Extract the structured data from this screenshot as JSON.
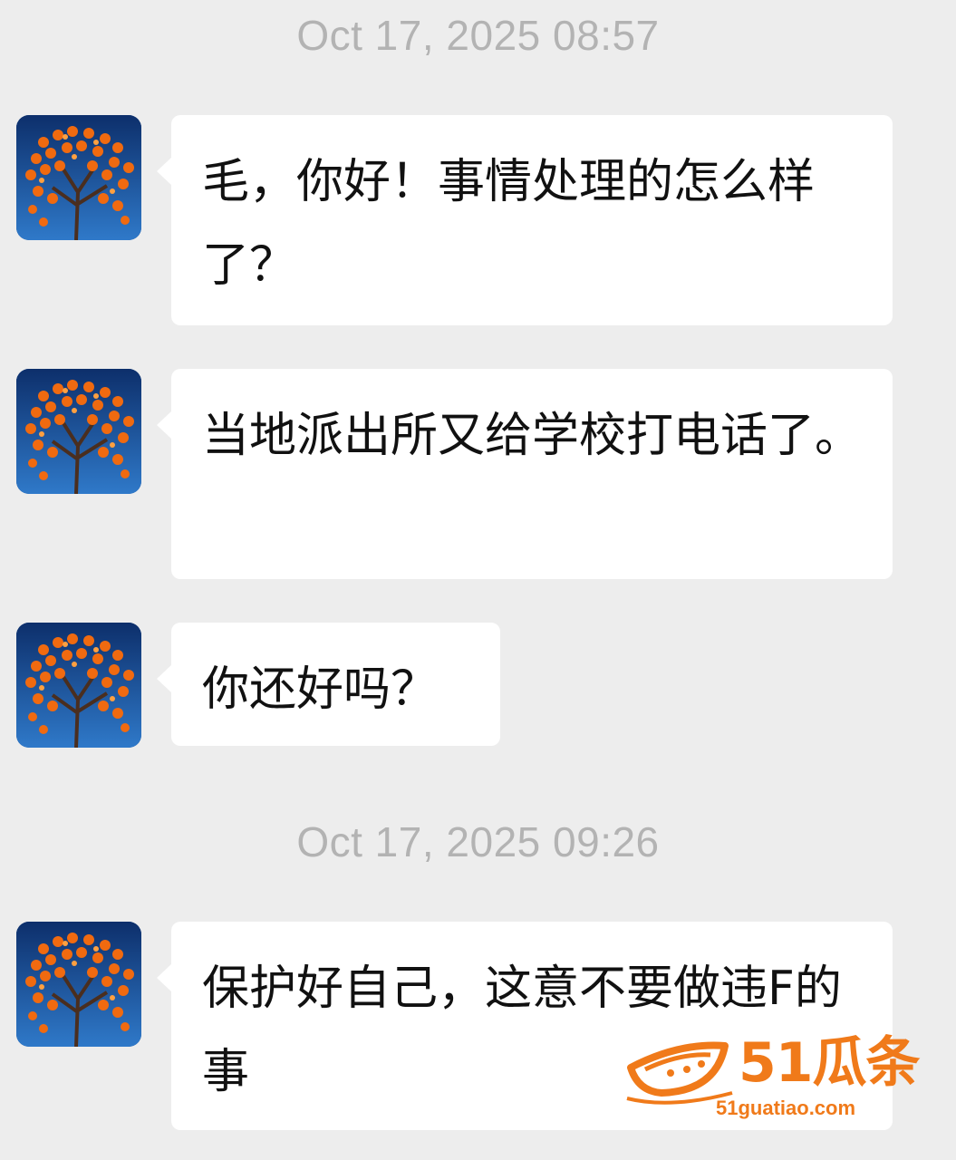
{
  "chat": {
    "timestamps": [
      {
        "text": "Oct 17, 2025 08:57"
      },
      {
        "text": "Oct 17, 2025 09:26"
      }
    ],
    "messages": [
      {
        "text": "毛，你好！事情处理的怎么样了？"
      },
      {
        "text": "当地派出所又给学校打电话了。"
      },
      {
        "text": "你还好吗？"
      },
      {
        "text": "保护好自己，这意不要做违F的事"
      }
    ]
  },
  "watermark": {
    "brand": "51瓜条",
    "url": "51guatiao.com",
    "color": "#f07a1a"
  },
  "icons": {
    "avatar": "persimmon-tree-avatar",
    "watermark_logo": "melon-logo-icon"
  }
}
